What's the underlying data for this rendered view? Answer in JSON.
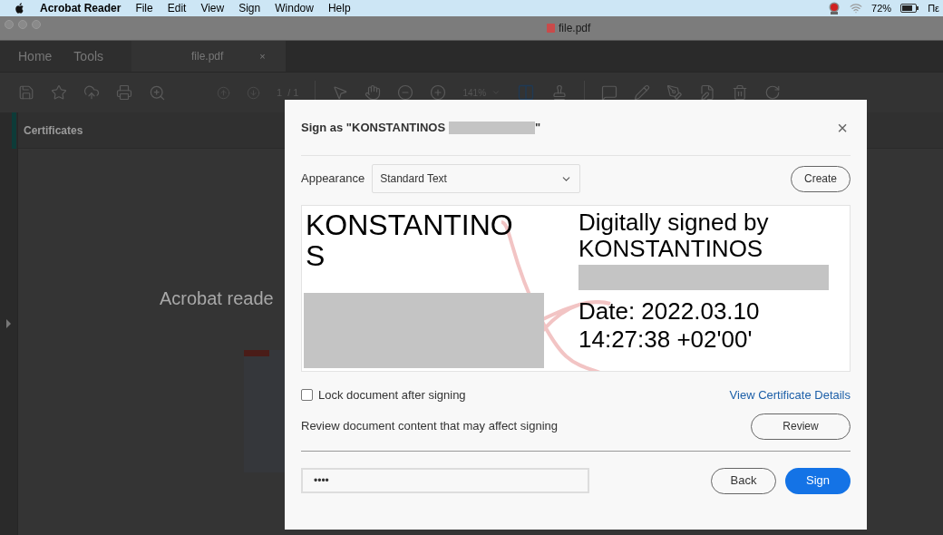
{
  "menu_bar": {
    "app": "Acrobat Reader",
    "items": [
      "File",
      "Edit",
      "View",
      "Sign",
      "Window",
      "Help"
    ],
    "battery": "72%",
    "clock": "Πε"
  },
  "window": {
    "title": "file.pdf"
  },
  "tabs": [
    {
      "kind": "nav",
      "label": "Home",
      "selected": false
    },
    {
      "kind": "nav",
      "label": "Tools",
      "selected": false
    },
    {
      "kind": "document",
      "label": "file.pdf",
      "selected": true,
      "close": "×"
    }
  ],
  "toolbar": {
    "page": "1",
    "page_total": "/ 1",
    "zoom": "141%"
  },
  "panel": {
    "title": "Certificates"
  },
  "document": {
    "heading": "Acrobat reade"
  },
  "dialog": {
    "title_prefix": "Sign as \"KONSTANTINOS",
    "title_suffix": "\"",
    "close": "×",
    "appearance_label": "Appearance",
    "appearance_value": "Standard Text",
    "create": "Create",
    "preview": {
      "name_lines": [
        "KONSTANTINO",
        "S"
      ],
      "info_lines": [
        "Digitally signed by",
        "KONSTANTINOS"
      ],
      "date_lines": [
        "Date: 2022.03.10",
        "14:27:38 +02'00'"
      ]
    },
    "lock": {
      "label": "Lock document after signing",
      "checked": false
    },
    "certificate_link": "View Certificate Details",
    "review_text": "Review document content that may affect signing",
    "review": "Review",
    "password": "••••",
    "back": "Back",
    "sign": "Sign"
  }
}
